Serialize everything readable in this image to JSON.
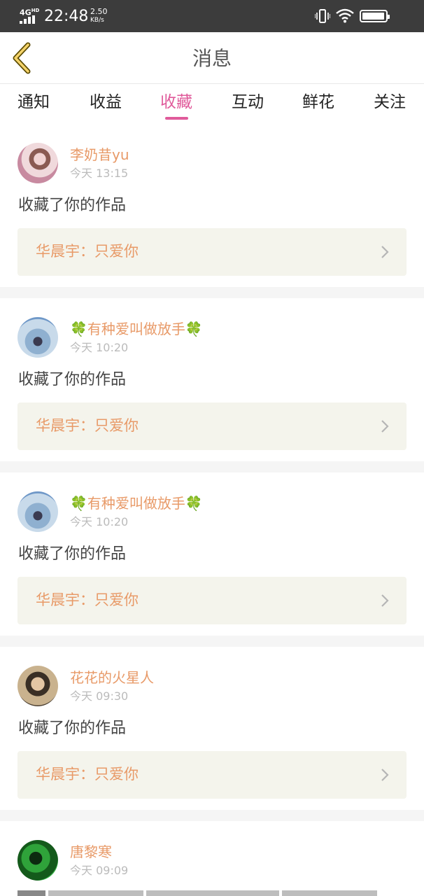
{
  "status_bar": {
    "network": "4G",
    "network_sup": "HD",
    "time": "22:48",
    "speed_value": "2.50",
    "speed_unit": "KB/s"
  },
  "header": {
    "title": "消息"
  },
  "tabs": [
    {
      "label": "通知",
      "active": false
    },
    {
      "label": "收益",
      "active": false
    },
    {
      "label": "收藏",
      "active": true
    },
    {
      "label": "互动",
      "active": false
    },
    {
      "label": "鲜花",
      "active": false
    },
    {
      "label": "关注",
      "active": false
    }
  ],
  "colors": {
    "accent": "#e05b9b",
    "username": "#e89a68",
    "card_link_bg": "#f4f4ec"
  },
  "items": [
    {
      "user": "李奶昔yu",
      "time": "今天 13:15",
      "action": "收藏了你的作品",
      "work": "华晨宇：只爱你"
    },
    {
      "user_prefix": "🍀",
      "user": "有种爱叫做放手",
      "user_suffix": "🍀",
      "time": "今天 10:20",
      "action": "收藏了你的作品",
      "work": "华晨宇：只爱你"
    },
    {
      "user_prefix": "🍀",
      "user": "有种爱叫做放手",
      "user_suffix": "🍀",
      "time": "今天 10:20",
      "action": "收藏了你的作品",
      "work": "华晨宇：只爱你"
    },
    {
      "user": "花花的火星人",
      "time": "今天 09:30",
      "action": "收藏了你的作品",
      "work": "华晨宇：只爱你"
    },
    {
      "user": "唐黎寒",
      "time": "今天 09:09"
    }
  ]
}
